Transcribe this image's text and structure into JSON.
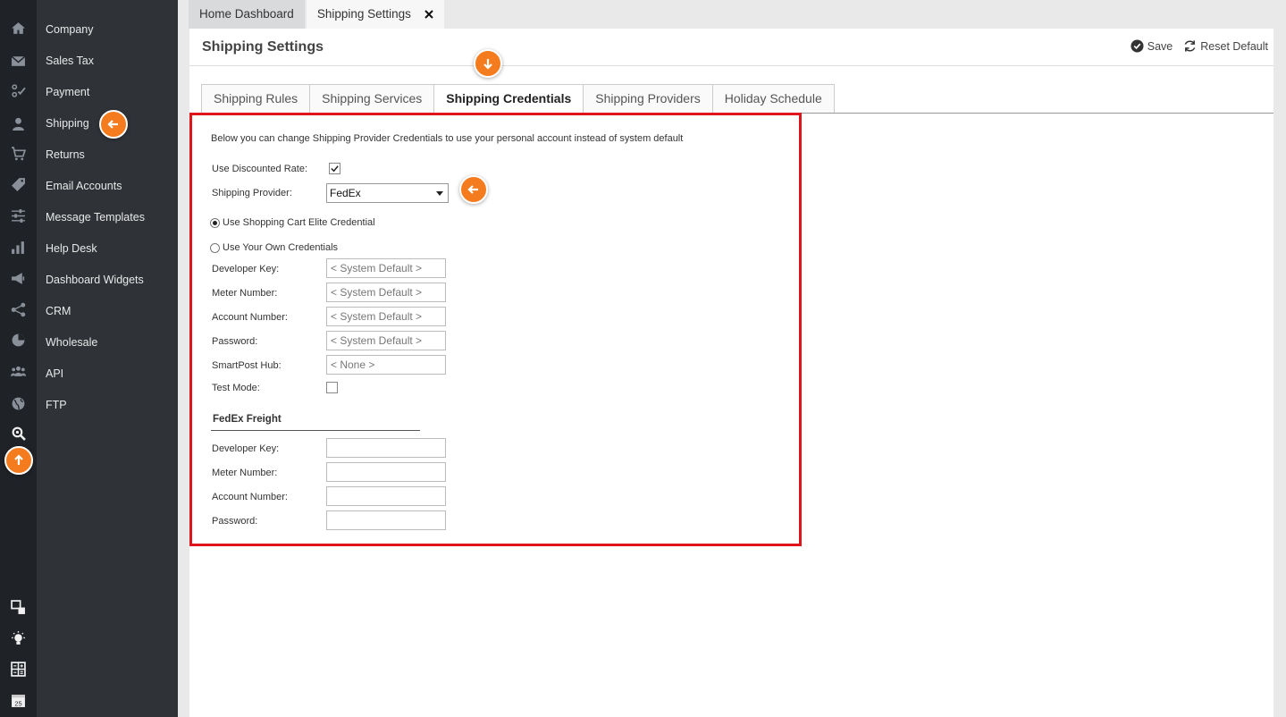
{
  "sidebar": {
    "items": [
      {
        "label": "Company",
        "icon": "home-icon"
      },
      {
        "label": "Sales Tax",
        "icon": "envelope-icon"
      },
      {
        "label": "Payment",
        "icon": "payment-icon"
      },
      {
        "label": "Shipping",
        "icon": "user-icon"
      },
      {
        "label": "Returns",
        "icon": "cart-icon"
      },
      {
        "label": "Email Accounts",
        "icon": "tag-icon"
      },
      {
        "label": "Message Templates",
        "icon": "sliders-icon"
      },
      {
        "label": "Help Desk",
        "icon": "bar-chart-icon"
      },
      {
        "label": "Dashboard Widgets",
        "icon": "megaphone-icon"
      },
      {
        "label": "CRM",
        "icon": "share-icon"
      },
      {
        "label": "Wholesale",
        "icon": "pie-chart-icon"
      },
      {
        "label": "API",
        "icon": "users-icon"
      },
      {
        "label": "FTP",
        "icon": "globe-icon"
      }
    ],
    "bottom_icons": [
      "settings-search-icon",
      "widgets-icon",
      "lightbulb-icon",
      "calculator-icon",
      "calendar-icon"
    ],
    "calendar_day": "25"
  },
  "tabs_top": {
    "home": "Home Dashboard",
    "shipping": "Shipping Settings"
  },
  "header": {
    "title": "Shipping Settings",
    "save": "Save",
    "reset": "Reset Default"
  },
  "tabs": [
    "Shipping Rules",
    "Shipping Services",
    "Shipping Credentials",
    "Shipping Providers",
    "Holiday Schedule"
  ],
  "active_tab": "Shipping Credentials",
  "form": {
    "intro": "Below you can change Shipping Provider Credentials to use your personal account instead of system default",
    "discounted_label": "Use Discounted Rate:",
    "discounted_checked": true,
    "provider_label": "Shipping Provider:",
    "provider_value": "FedEx",
    "radio_elite": "Use Shopping Cart Elite Credential",
    "radio_own": "Use Your Own Credentials",
    "selected_credential": "elite",
    "fields": {
      "developer_key": {
        "label": "Developer Key:",
        "placeholder": "< System Default >"
      },
      "meter_number": {
        "label": "Meter Number:",
        "placeholder": "< System Default >"
      },
      "account_number": {
        "label": "Account Number:",
        "placeholder": "< System Default >"
      },
      "password": {
        "label": "Password:",
        "placeholder": "< System Default >"
      },
      "smartpost_hub": {
        "label": "SmartPost Hub:",
        "placeholder": "< None >"
      }
    },
    "test_mode_label": "Test Mode:",
    "test_mode_checked": false,
    "freight": {
      "title": "FedEx Freight",
      "developer_key": "Developer Key:",
      "meter_number": "Meter Number:",
      "account_number": "Account Number:",
      "password": "Password:"
    }
  },
  "colors": {
    "accent": "#f47c1f",
    "highlight_frame": "#e0151b",
    "sidebar_dark": "#1f2328",
    "sidebar_menu": "#2f3338"
  }
}
